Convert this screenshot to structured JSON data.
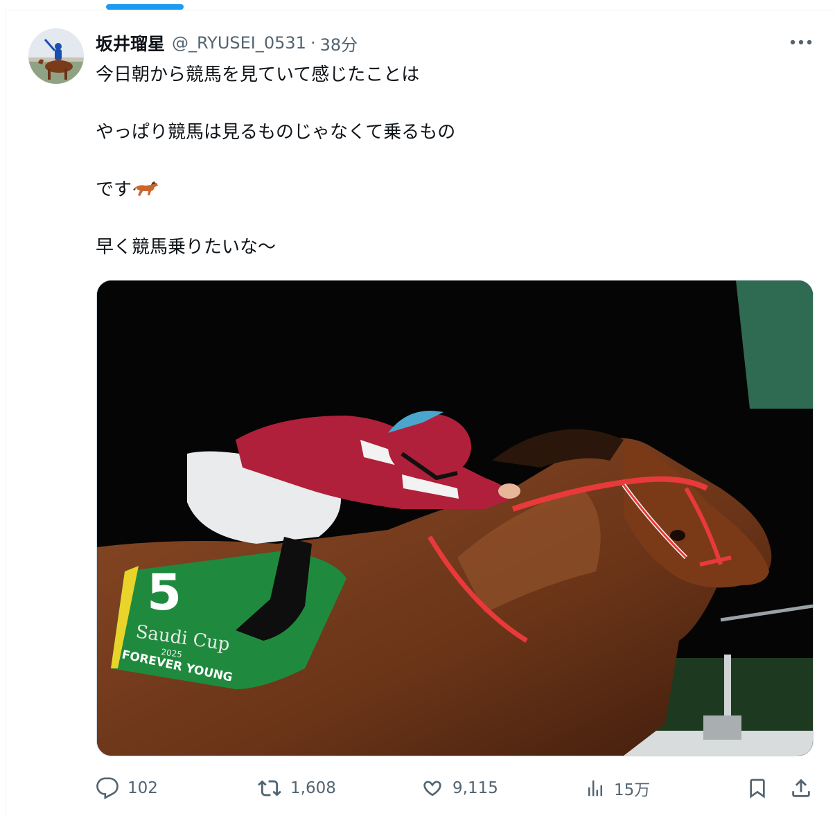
{
  "tweet": {
    "author_name": "坂井瑠星",
    "handle": "@_RYUSEI_0531",
    "separator": "·",
    "time": "38分",
    "text_lines": [
      "今日朝から競馬を見ていて感じたことは",
      "やっぱり競馬は見るものじゃなくて乗るもの",
      "です",
      "早く競馬乗りたいな〜"
    ],
    "emoji": "🐎",
    "media": {
      "saddle_cloth_number": "5",
      "saddle_cloth_brand": "Saudi Cup",
      "saddle_cloth_year": "2025",
      "saddle_cloth_horse_name": "FOREVER YOUNG"
    }
  },
  "metrics": {
    "replies": "102",
    "reposts": "1,608",
    "likes": "9,115",
    "views": "15万"
  },
  "icons": {
    "more": "more-horizontal-icon",
    "reply": "reply-icon",
    "repost": "repost-icon",
    "like": "heart-icon",
    "views": "views-chart-icon",
    "bookmark": "bookmark-icon",
    "share": "share-icon"
  },
  "colors": {
    "accent": "#1d9bf0",
    "text_primary": "#0f1419",
    "text_secondary": "#536471",
    "border": "#cfd9de"
  }
}
